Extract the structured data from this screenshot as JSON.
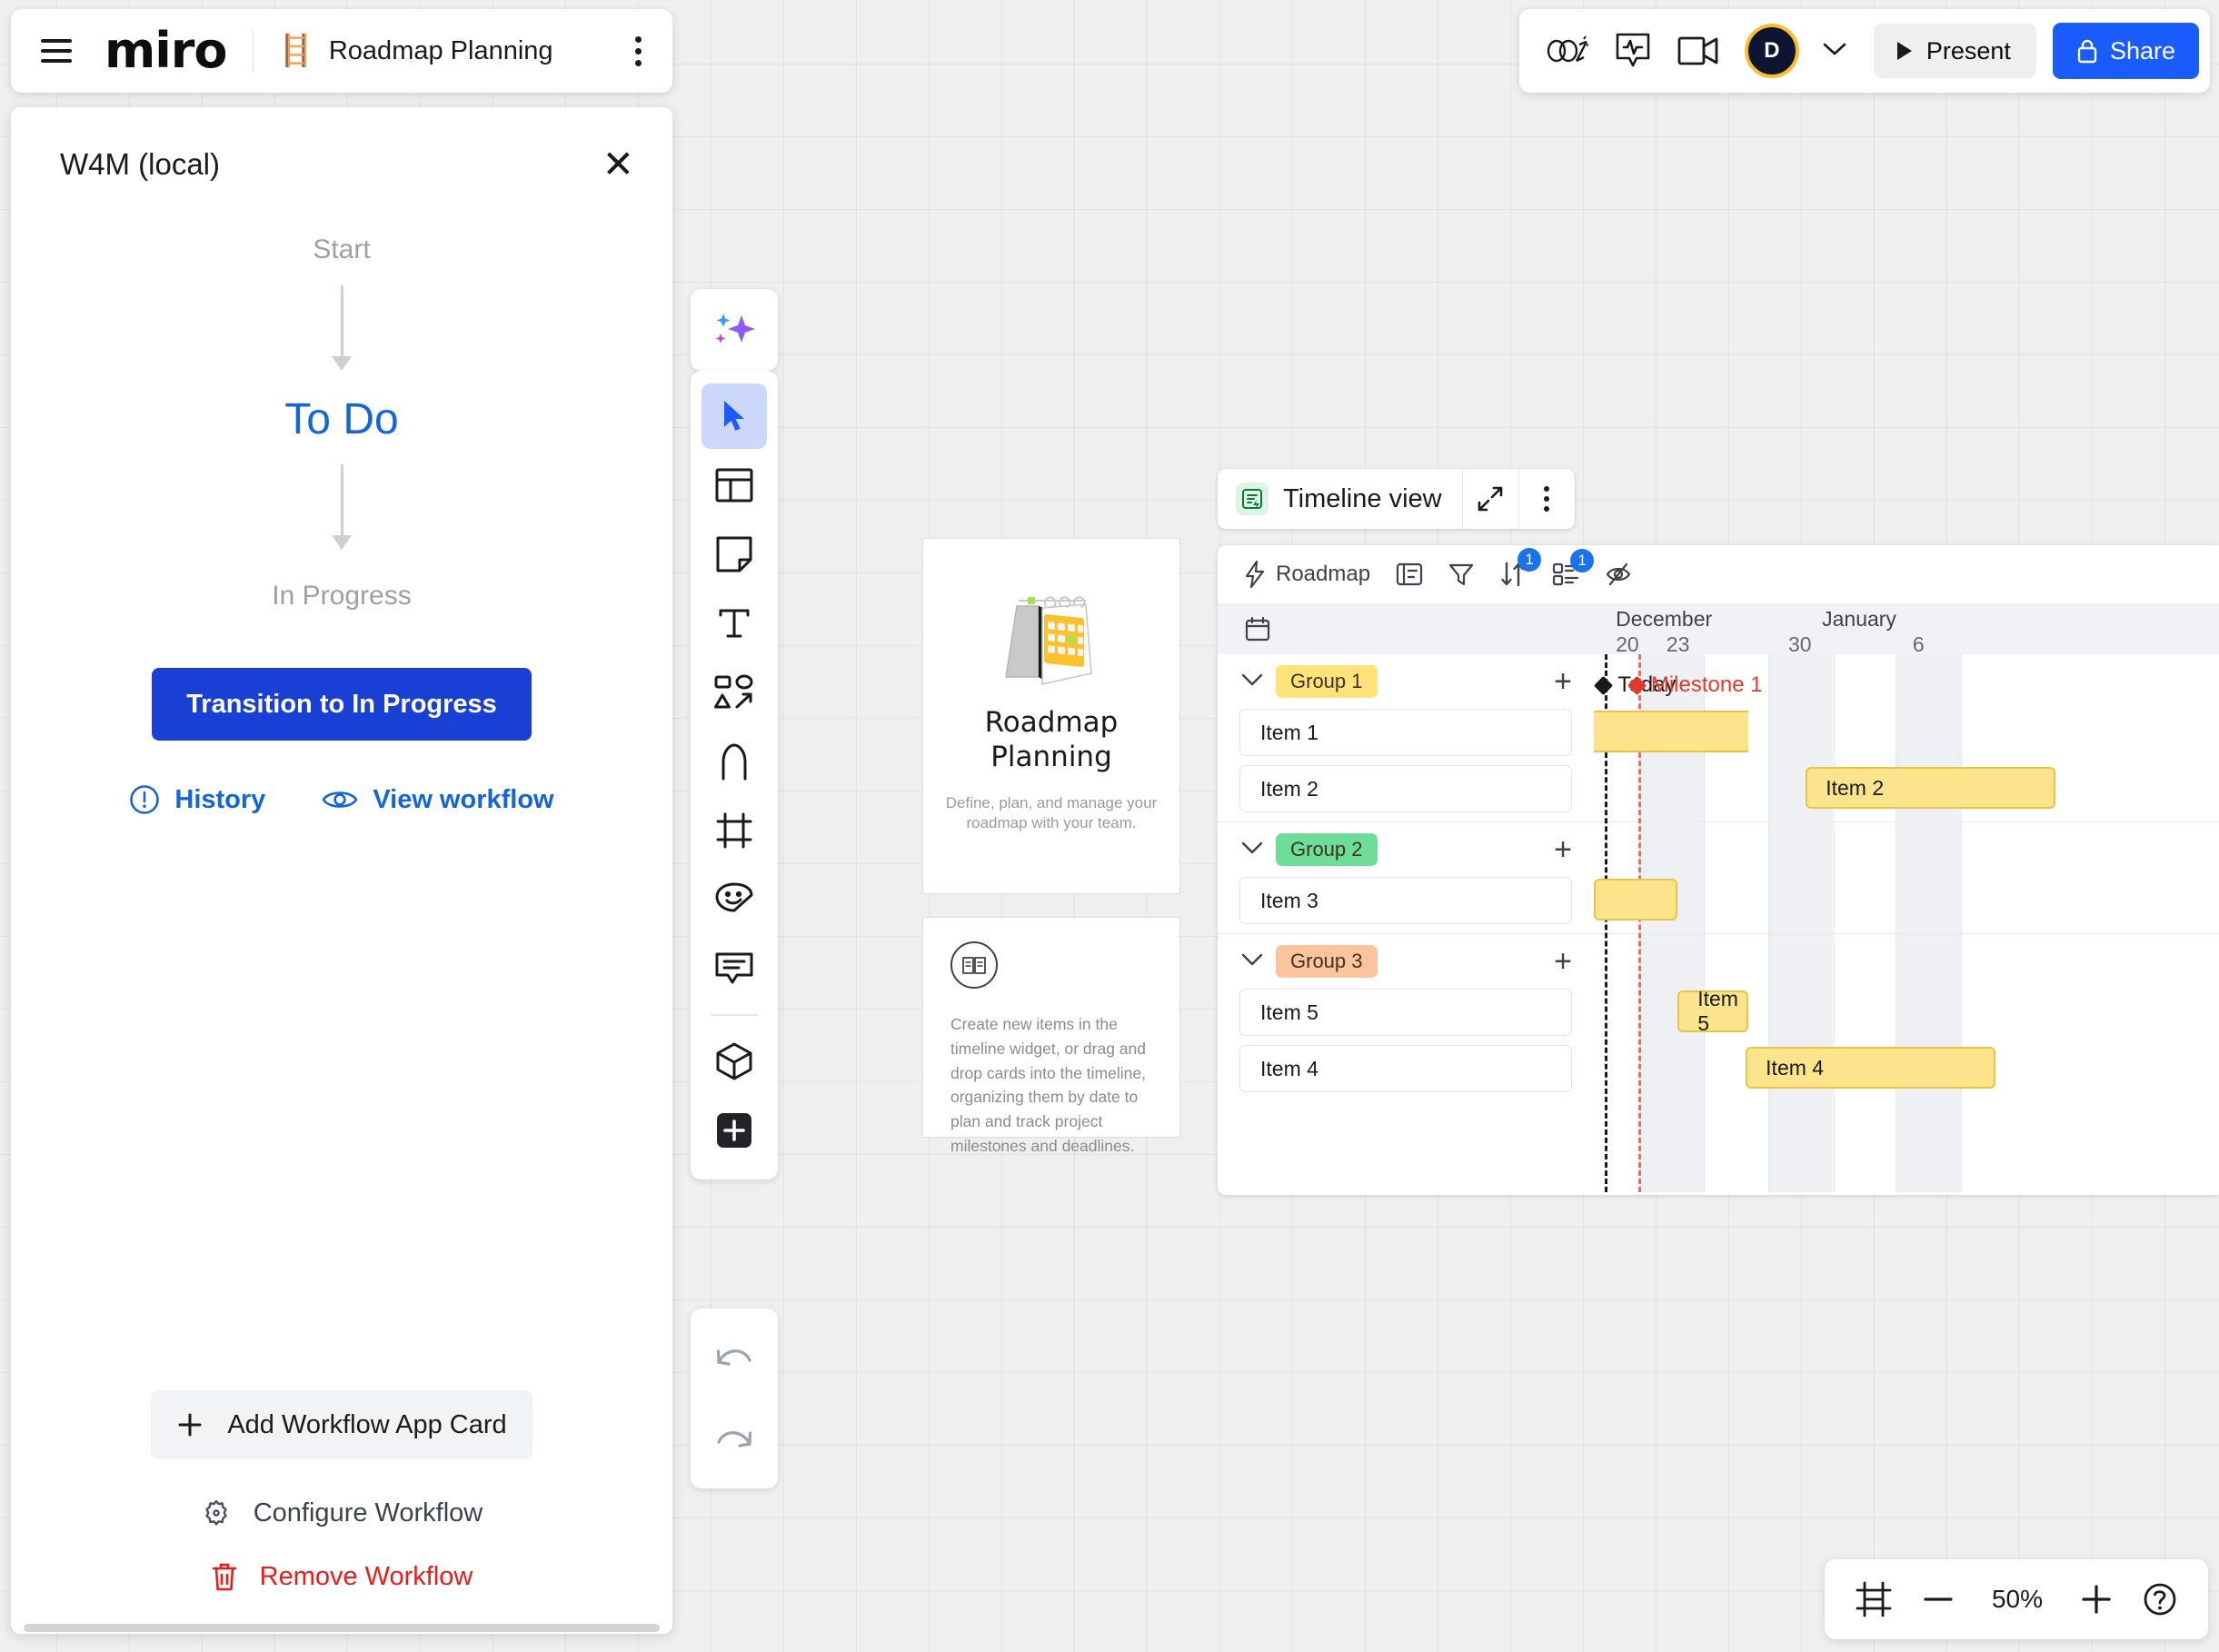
{
  "header": {
    "menu_icon": "hamburger-menu-icon",
    "logo_text": "miro",
    "board_emoji": "🪜",
    "board_title": "Roadmap Planning",
    "more_icon": "more-vertical-icon"
  },
  "header_right": {
    "celebrate_icon": "celebration-icon",
    "activity_icon": "activity-pulse-icon",
    "video_icon": "video-camera-icon",
    "avatar_initial": "D",
    "avatar_ring_color": "#ffbd2e",
    "avatar_bg_color": "#0c1633",
    "present_label": "Present",
    "share_label": "Share",
    "share_color": "#1a5cff"
  },
  "panel": {
    "title": "W4M (local)",
    "close_icon": "close-icon",
    "flow": {
      "start": "Start",
      "current": "To Do",
      "next": "In Progress",
      "current_color": "#1565d8"
    },
    "transition_button": "Transition to In Progress",
    "transition_color": "#1a3fd4",
    "links": [
      {
        "label": "History",
        "icon": "alert-circle-icon"
      },
      {
        "label": "View workflow",
        "icon": "eye-icon"
      }
    ],
    "add_card_button": "Add Workflow App Card",
    "configure_label": "Configure Workflow",
    "configure_icon": "gear-icon",
    "remove_label": "Remove Workflow",
    "remove_icon": "trash-icon",
    "remove_color": "#f01919"
  },
  "toolbar": {
    "ai_icon": "ai-sparkles-icon",
    "tools": [
      {
        "name": "cursor-select-tool",
        "icon": "cursor-arrow-icon",
        "selected": true
      },
      {
        "name": "templates-tool",
        "icon": "templates-grid-icon",
        "selected": false
      },
      {
        "name": "sticky-note-tool",
        "icon": "sticky-note-icon",
        "selected": false
      },
      {
        "name": "text-tool",
        "icon": "text-T-icon",
        "selected": false
      },
      {
        "name": "shapes-tool",
        "icon": "shapes-connector-icon",
        "selected": false
      },
      {
        "name": "pen-tool",
        "icon": "pen-icon",
        "selected": false
      },
      {
        "name": "frame-tool",
        "icon": "frame-icon",
        "selected": false
      },
      {
        "name": "stickers-tool",
        "icon": "sticker-smiley-icon",
        "selected": false
      },
      {
        "name": "comment-tool",
        "icon": "comment-bubble-icon",
        "selected": false
      },
      {
        "name": "apps-tool",
        "icon": "cube-box-icon",
        "selected": false
      },
      {
        "name": "more-apps-tool",
        "icon": "plus-square-icon",
        "selected": false
      }
    ],
    "undo_icon": "undo-arrow-icon",
    "redo_icon": "redo-arrow-icon"
  },
  "roadmap_card": {
    "icon": "calendar-illustration",
    "title_line1": "Roadmap",
    "title_line2": "Planning",
    "subtitle": "Define, plan, and manage your roadmap with your team."
  },
  "info_card": {
    "icon": "book-info-icon",
    "text": "Create new items in the timeline widget, or drag and drop cards into the timeline, organizing them by date to plan and track project milestones and deadlines."
  },
  "timeline": {
    "title": "Timeline view",
    "title_icon": "timeline-doc-icon",
    "expand_icon": "expand-diagonal-icon",
    "more_icon": "more-vertical-icon",
    "toolbar": {
      "source_label": "Roadmap",
      "source_icon": "lightning-bolt-icon",
      "fields_icon": "card-fields-icon",
      "filter_icon": "filter-funnel-icon",
      "sort_icon": "sort-arrows-icon",
      "sort_badge": "1",
      "group_icon": "group-list-icon",
      "group_badge": "1",
      "hide_icon": "hide-eye-slash-icon"
    },
    "calendar_icon": "calendar-icon",
    "months": [
      {
        "label": "December",
        "left_pct": 3.5
      },
      {
        "label": "January",
        "left_pct": 36.5
      }
    ],
    "days": [
      {
        "label": "20",
        "left_pct": 3.5
      },
      {
        "label": "23",
        "left_pct": 11.6
      },
      {
        "label": "30",
        "left_pct": 31.1
      },
      {
        "label": "6",
        "left_pct": 51.0
      }
    ],
    "markers": [
      {
        "label": "Today",
        "color": "#1a1a1a",
        "left_pct": 1.8
      },
      {
        "label": "Milestone 1",
        "color": "#e03b2a",
        "left_pct": 7.1
      }
    ],
    "groups": [
      {
        "name": "Group 1",
        "chip_color": "#ffe27a",
        "add_icon": "plus-icon",
        "chevron_icon": "chevron-down-icon",
        "items": [
          {
            "label": "Item 1",
            "bar_label": "",
            "bar_left_pct": 0.0,
            "bar_width_pct": 24.7,
            "flat": true
          },
          {
            "label": "Item 2",
            "bar_label": "Item 2",
            "bar_left_pct": 33.9,
            "bar_width_pct": 40.0,
            "flat": false
          }
        ]
      },
      {
        "name": "Group 2",
        "chip_color": "#6edd9a",
        "add_icon": "plus-icon",
        "chevron_icon": "chevron-down-icon",
        "items": [
          {
            "label": "Item 3",
            "bar_label": "",
            "bar_left_pct": 0.0,
            "bar_width_pct": 13.3,
            "flat": false
          }
        ]
      },
      {
        "name": "Group 3",
        "chip_color": "#fbc49c",
        "add_icon": "plus-icon",
        "chevron_icon": "chevron-down-icon",
        "items": [
          {
            "label": "Item 5",
            "bar_label": "Item 5",
            "bar_left_pct": 13.4,
            "bar_width_pct": 11.3,
            "flat": false
          },
          {
            "label": "Item 4",
            "bar_label": "Item 4",
            "bar_left_pct": 24.3,
            "bar_width_pct": 40.0,
            "flat": false
          }
        ]
      }
    ],
    "bar_fill": "#fce48d",
    "bar_border": "#e8c44a",
    "weekends": [
      {
        "left_pct": 7.2,
        "width_pct": 10.4
      },
      {
        "left_pct": 27.9,
        "width_pct": 10.4
      },
      {
        "left_pct": 48.3,
        "width_pct": 10.4
      }
    ]
  },
  "zoom_control": {
    "fit_icon": "fit-to-screen-icon",
    "minus_icon": "minus-icon",
    "value": "50%",
    "plus_icon": "plus-icon",
    "help_icon": "help-question-icon"
  }
}
